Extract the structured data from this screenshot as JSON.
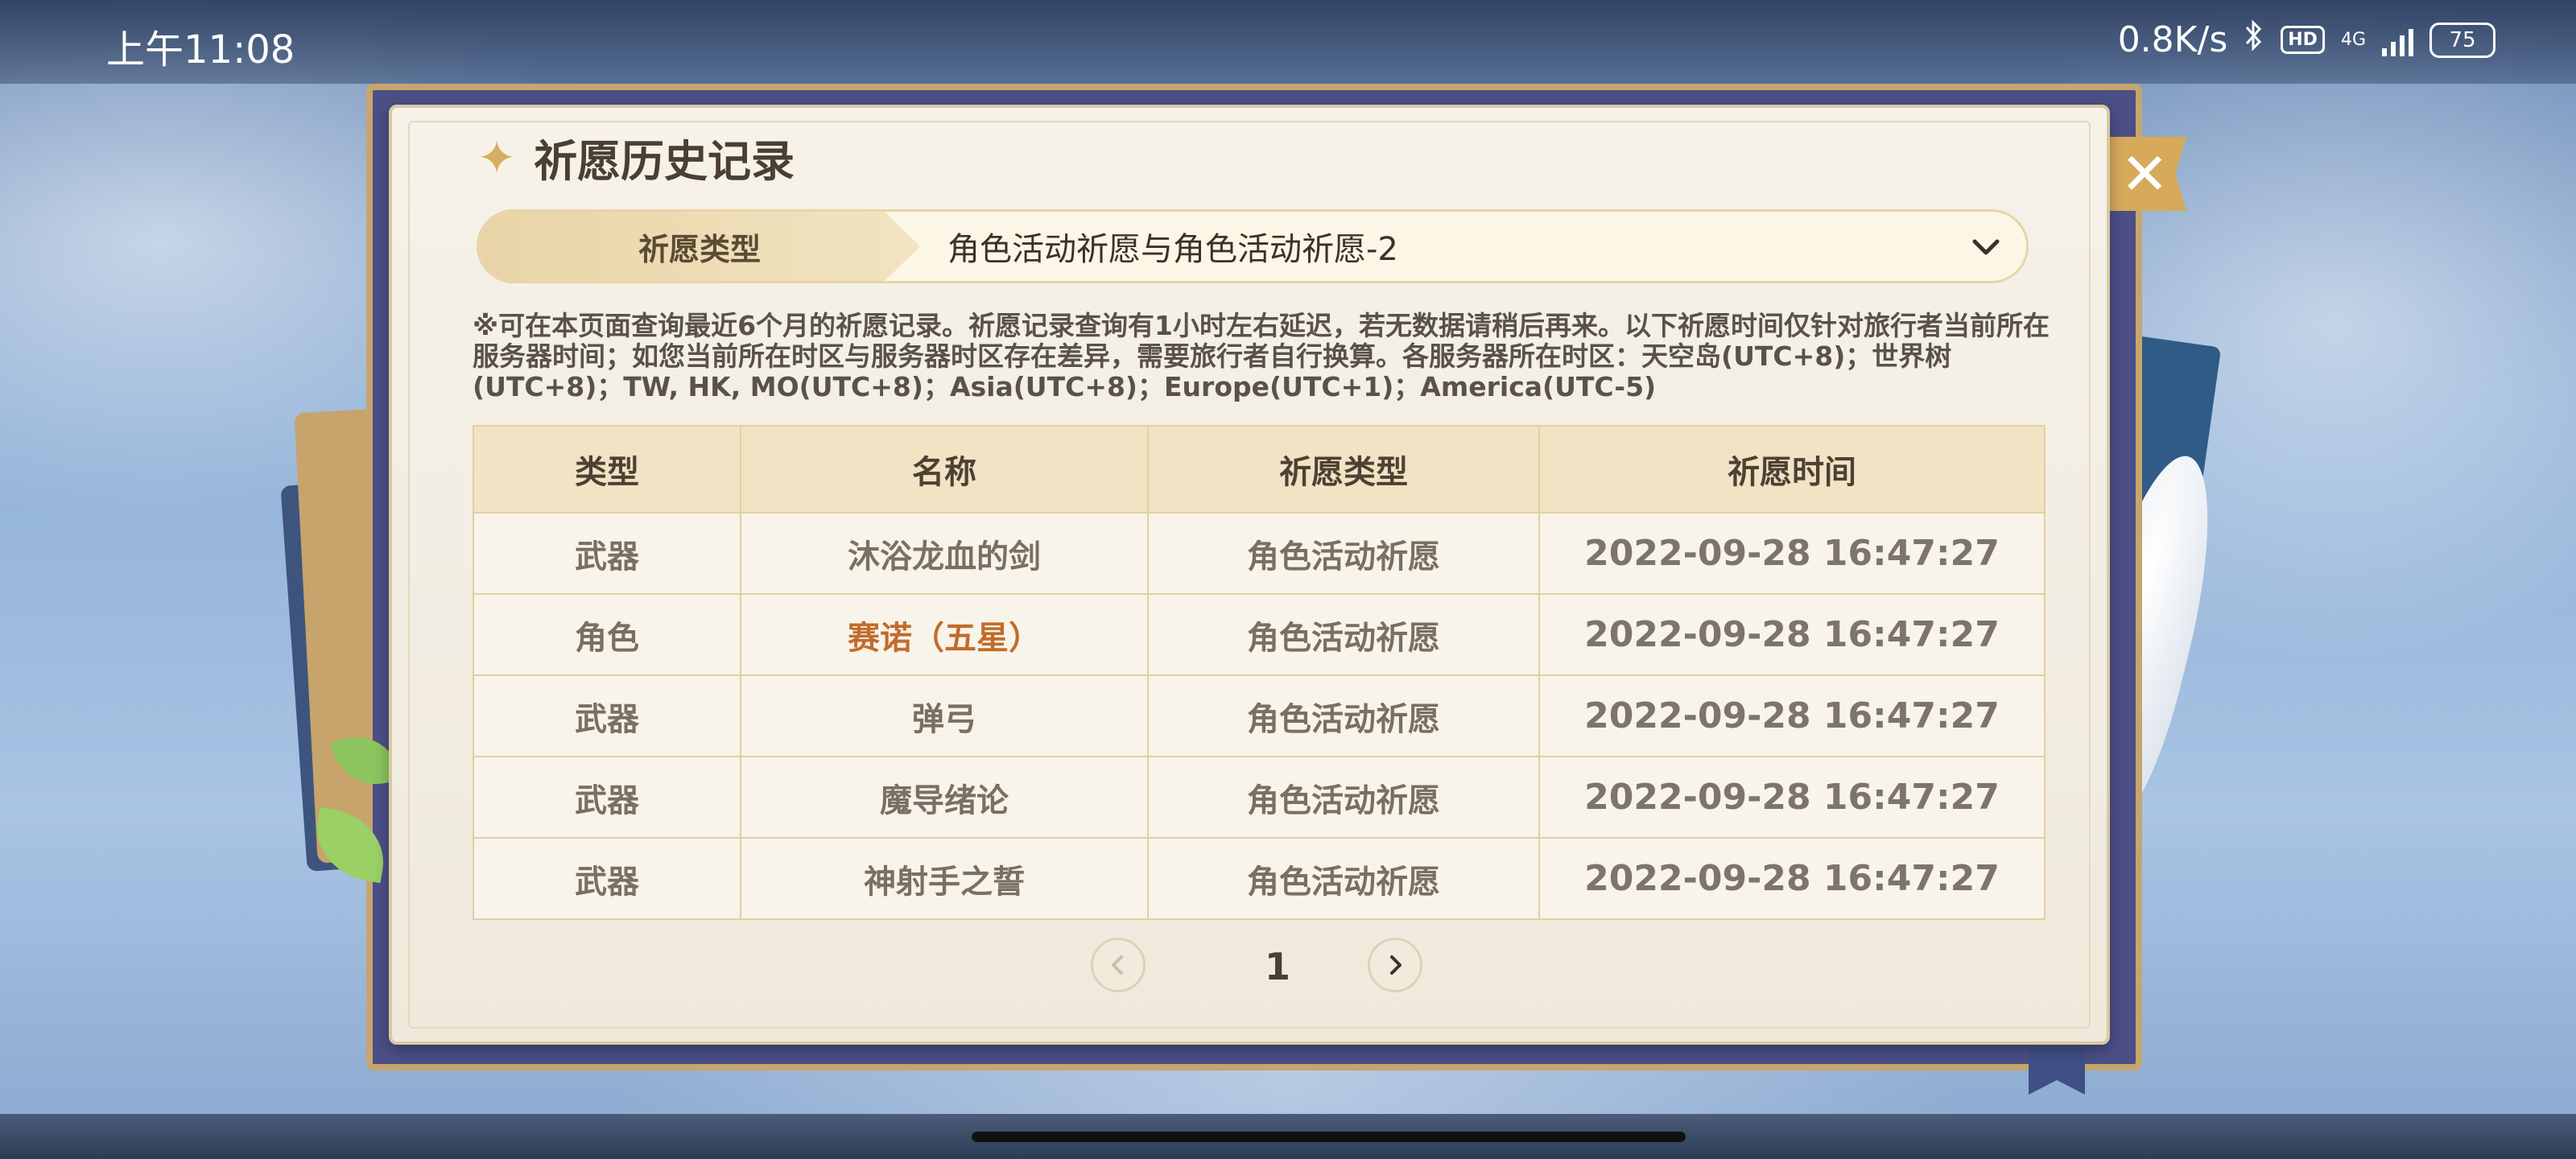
{
  "status_bar": {
    "time": "上午11:08",
    "speed": "0.8K/s",
    "hd": "HD",
    "network": "4G",
    "battery": "75"
  },
  "dialog": {
    "title": "祈愿历史记录",
    "close_icon": "close-icon",
    "selector": {
      "label": "祈愿类型",
      "value": "角色活动祈愿与角色活动祈愿-2"
    },
    "notice": "※可在本页面查询最近6个月的祈愿记录。祈愿记录查询有1小时左右延迟，若无数据请稍后再来。以下祈愿时间仅针对旅行者当前所在服务器时间；如您当前所在时区与服务器时区存在差异，需要旅行者自行换算。各服务器所在时区：天空岛(UTC+8)；世界树(UTC+8)；TW, HK, MO(UTC+8)；Asia(UTC+8)；Europe(UTC+1)；America(UTC-5)",
    "table": {
      "headers": [
        "类型",
        "名称",
        "祈愿类型",
        "祈愿时间"
      ],
      "rows": [
        {
          "type": "武器",
          "name": "沐浴龙血的剑",
          "wish": "角色活动祈愿",
          "time": "2022-09-28 16:47:27"
        },
        {
          "type": "角色",
          "name": "赛诺（五星）",
          "wish": "角色活动祈愿",
          "time": "2022-09-28 16:47:27",
          "highlight": "#c26c2c"
        },
        {
          "type": "武器",
          "name": "弹弓",
          "wish": "角色活动祈愿",
          "time": "2022-09-28 16:47:27"
        },
        {
          "type": "武器",
          "name": "魔导绪论",
          "wish": "角色活动祈愿",
          "time": "2022-09-28 16:47:27"
        },
        {
          "type": "武器",
          "name": "神射手之誓",
          "wish": "角色活动祈愿",
          "time": "2022-09-28 16:47:27"
        }
      ]
    },
    "pagination": {
      "current": "1",
      "prev_icon": "chevron-left-icon",
      "next_icon": "chevron-right-icon"
    }
  },
  "colors": {
    "accent_gold": "#d7a95a",
    "five_star": "#c26c2c",
    "panel_bg": "#f6f2e9"
  }
}
